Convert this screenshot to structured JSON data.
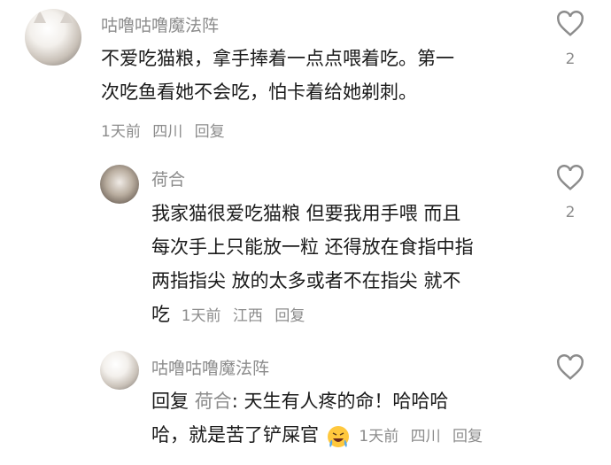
{
  "comments": [
    {
      "username": "咕噜咕噜魔法阵",
      "line1": "不爱吃猫粮，拿手捧着一点点喂着吃。第一",
      "line2": "次吃鱼看她不会吃，怕卡着给她剃刺。",
      "time": "1天前",
      "location": "四川",
      "reply": "回复",
      "likes": "2"
    },
    {
      "username": "荷合",
      "line1": "我家猫很爱吃猫粮 但要我用手喂 而且",
      "line2": "每次手上只能放一粒 还得放在食指中指",
      "line3": "两指指尖 放的太多或者不在指尖 就不",
      "line4": "吃",
      "time": "1天前",
      "location": "江西",
      "reply": "回复",
      "likes": "2"
    },
    {
      "username": "咕噜咕噜魔法阵",
      "reply_prefix": "回复",
      "reply_to": "荷合",
      "line1_rest": ": 天生有人疼的命！哈哈哈",
      "line2": "哈，就是苦了铲屎官",
      "time": "1天前",
      "location": "四川",
      "reply": "回复"
    }
  ],
  "icons": {
    "like": "heart-outline-icon",
    "emoji": "crying-laughing-emoji"
  },
  "colors": {
    "secondary_text": "#8c8c8c",
    "primary_text": "#1a1a1a"
  }
}
